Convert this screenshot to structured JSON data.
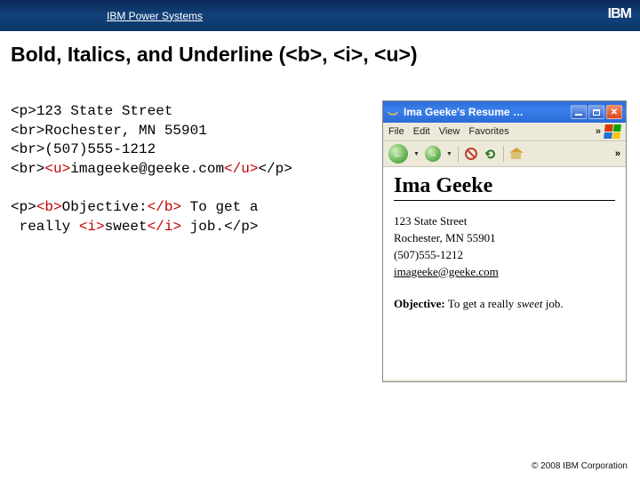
{
  "header": {
    "brand": "IBM Power Systems",
    "logo": "IBM"
  },
  "slide": {
    "title": "Bold, Italics, and Underline (<b>, <i>, <u>)"
  },
  "code": {
    "l1a": "<p>",
    "l1b": "123 State Street",
    "l2a": "<br>",
    "l2b": "Rochester, MN 55901",
    "l3a": "<br>",
    "l3b": "(507)555-1212",
    "l4a": "<br>",
    "l4u1": "<u>",
    "l4b": "imageeke@geeke.com",
    "l4u2": "</u>",
    "l4c": "</p>",
    "blank": " ",
    "l5a": "<p>",
    "l5b1": "<b>",
    "l5b": "Objective:",
    "l5b2": "</b>",
    "l5c": " To get a",
    "l6a": " really ",
    "l6i1": "<i>",
    "l6b": "sweet",
    "l6i2": "</i>",
    "l6c": " job.",
    "l6d": "</p>"
  },
  "browser": {
    "title": "Ima Geeke's Resume …",
    "menus": {
      "file": "File",
      "edit": "Edit",
      "view": "View",
      "fav": "Favorites",
      "chev": "»"
    },
    "toolbar": {
      "chev": "»"
    },
    "page": {
      "name": "Ima Geeke",
      "contact1": "123 State Street",
      "contact2": "Rochester, MN 55901",
      "contact3": "(507)555-1212",
      "email": "imageeke@geeke.com",
      "obj_label": "Objective:",
      "obj_text1": " To get a really ",
      "obj_sweet": "sweet",
      "obj_text2": " job."
    }
  },
  "footer": {
    "copy": "© 2008 IBM Corporation"
  }
}
